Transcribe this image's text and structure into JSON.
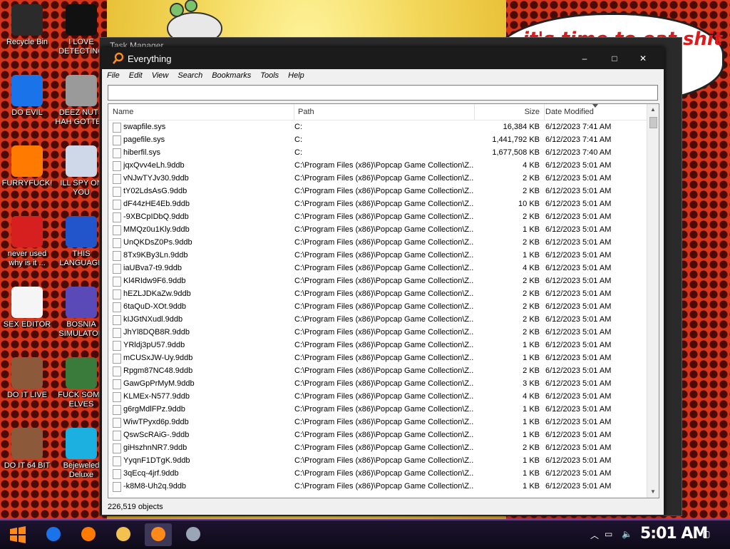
{
  "window": {
    "title": "Everything",
    "bg_title": "Task Manager"
  },
  "speech": {
    "text": "it's time to eat shit\n          w"
  },
  "desktop_icons": [
    {
      "label": "Recycle Bin",
      "color": "#2b2b2b"
    },
    {
      "label": "I LOVE\nDETECTING",
      "color": "#111111"
    },
    {
      "label": "DO EVIL",
      "color": "#1a73e8"
    },
    {
      "label": "DEEZ NUTS\nHAH GOTTEM",
      "color": "#9a9a9a"
    },
    {
      "label": "FURRYFUCK!",
      "color": "#ff7a00"
    },
    {
      "label": "ILL SPY ON\nYOU",
      "color": "#cfd8e8"
    },
    {
      "label": "never used\nwhy is it ...",
      "color": "#d62020"
    },
    {
      "label": "THIS\nLANGUAGE",
      "color": "#2255cc"
    },
    {
      "label": "SEX EDITOR",
      "color": "#f5f5f5"
    },
    {
      "label": "BOSNIA\nSIMULATOR",
      "color": "#5a4ab8"
    },
    {
      "label": "DO IT LIVE",
      "color": "#8c5a3a"
    },
    {
      "label": "FUCK SOME\nELVES",
      "color": "#3a7a3a"
    },
    {
      "label": "DO IT 64 BIT",
      "color": "#8c5a3a"
    },
    {
      "label": "Bejeweled\nDeluxe",
      "color": "#1bb0e0"
    }
  ],
  "menu": [
    "File",
    "Edit",
    "View",
    "Search",
    "Bookmarks",
    "Tools",
    "Help"
  ],
  "search": {
    "value": ""
  },
  "columns": {
    "name": "Name",
    "path": "Path",
    "size": "Size",
    "date": "Date Modified"
  },
  "files": [
    {
      "name": "swapfile.sys",
      "path": "C:",
      "size": "16,384 KB",
      "date": "6/12/2023 7:41 AM"
    },
    {
      "name": "pagefile.sys",
      "path": "C:",
      "size": "1,441,792 KB",
      "date": "6/12/2023 7:41 AM"
    },
    {
      "name": "hiberfil.sys",
      "path": "C:",
      "size": "1,677,508 KB",
      "date": "6/12/2023 7:40 AM"
    },
    {
      "name": "jqxQvv4eLh.9ddb",
      "path": "C:\\Program Files (x86)\\Popcap Game Collection\\Z...",
      "size": "4 KB",
      "date": "6/12/2023 5:01 AM"
    },
    {
      "name": "vNJwTYJv30.9ddb",
      "path": "C:\\Program Files (x86)\\Popcap Game Collection\\Z...",
      "size": "2 KB",
      "date": "6/12/2023 5:01 AM"
    },
    {
      "name": "tY02LdsAsG.9ddb",
      "path": "C:\\Program Files (x86)\\Popcap Game Collection\\Z...",
      "size": "2 KB",
      "date": "6/12/2023 5:01 AM"
    },
    {
      "name": "dF44zHE4Eb.9ddb",
      "path": "C:\\Program Files (x86)\\Popcap Game Collection\\Z...",
      "size": "10 KB",
      "date": "6/12/2023 5:01 AM"
    },
    {
      "name": "-9XBCpIDbQ.9ddb",
      "path": "C:\\Program Files (x86)\\Popcap Game Collection\\Z...",
      "size": "2 KB",
      "date": "6/12/2023 5:01 AM"
    },
    {
      "name": "MMQz0u1Kly.9ddb",
      "path": "C:\\Program Files (x86)\\Popcap Game Collection\\Z...",
      "size": "1 KB",
      "date": "6/12/2023 5:01 AM"
    },
    {
      "name": "UnQKDsZ0Ps.9ddb",
      "path": "C:\\Program Files (x86)\\Popcap Game Collection\\Z...",
      "size": "2 KB",
      "date": "6/12/2023 5:01 AM"
    },
    {
      "name": "8Tx9KBy3Ln.9ddb",
      "path": "C:\\Program Files (x86)\\Popcap Game Collection\\Z...",
      "size": "1 KB",
      "date": "6/12/2023 5:01 AM"
    },
    {
      "name": "iaUBva7-t9.9ddb",
      "path": "C:\\Program Files (x86)\\Popcap Game Collection\\Z...",
      "size": "4 KB",
      "date": "6/12/2023 5:01 AM"
    },
    {
      "name": "Kl4RIdw9F6.9ddb",
      "path": "C:\\Program Files (x86)\\Popcap Game Collection\\Z...",
      "size": "2 KB",
      "date": "6/12/2023 5:01 AM"
    },
    {
      "name": "hEZLJDKaZw.9ddb",
      "path": "C:\\Program Files (x86)\\Popcap Game Collection\\Z...",
      "size": "2 KB",
      "date": "6/12/2023 5:01 AM"
    },
    {
      "name": "6taQuD-XOt.9ddb",
      "path": "C:\\Program Files (x86)\\Popcap Game Collection\\Z...",
      "size": "2 KB",
      "date": "6/12/2023 5:01 AM"
    },
    {
      "name": "kIJGtNXudl.9ddb",
      "path": "C:\\Program Files (x86)\\Popcap Game Collection\\Z...",
      "size": "2 KB",
      "date": "6/12/2023 5:01 AM"
    },
    {
      "name": "JhYl8DQB8R.9ddb",
      "path": "C:\\Program Files (x86)\\Popcap Game Collection\\Z...",
      "size": "2 KB",
      "date": "6/12/2023 5:01 AM"
    },
    {
      "name": "YRldj3pU57.9ddb",
      "path": "C:\\Program Files (x86)\\Popcap Game Collection\\Z...",
      "size": "1 KB",
      "date": "6/12/2023 5:01 AM"
    },
    {
      "name": "mCUSxJW-Uy.9ddb",
      "path": "C:\\Program Files (x86)\\Popcap Game Collection\\Z...",
      "size": "1 KB",
      "date": "6/12/2023 5:01 AM"
    },
    {
      "name": "Rpgm87NC48.9ddb",
      "path": "C:\\Program Files (x86)\\Popcap Game Collection\\Z...",
      "size": "2 KB",
      "date": "6/12/2023 5:01 AM"
    },
    {
      "name": "GawGpPrMyM.9ddb",
      "path": "C:\\Program Files (x86)\\Popcap Game Collection\\Z...",
      "size": "3 KB",
      "date": "6/12/2023 5:01 AM"
    },
    {
      "name": "KLMEx-N577.9ddb",
      "path": "C:\\Program Files (x86)\\Popcap Game Collection\\Z...",
      "size": "4 KB",
      "date": "6/12/2023 5:01 AM"
    },
    {
      "name": "g6rgMdlFPz.9ddb",
      "path": "C:\\Program Files (x86)\\Popcap Game Collection\\Z...",
      "size": "1 KB",
      "date": "6/12/2023 5:01 AM"
    },
    {
      "name": "WiwTPyxd6p.9ddb",
      "path": "C:\\Program Files (x86)\\Popcap Game Collection\\Z...",
      "size": "1 KB",
      "date": "6/12/2023 5:01 AM"
    },
    {
      "name": "QswScRAiG-.9ddb",
      "path": "C:\\Program Files (x86)\\Popcap Game Collection\\Z...",
      "size": "1 KB",
      "date": "6/12/2023 5:01 AM"
    },
    {
      "name": "giHszhnNR7.9ddb",
      "path": "C:\\Program Files (x86)\\Popcap Game Collection\\Z...",
      "size": "2 KB",
      "date": "6/12/2023 5:01 AM"
    },
    {
      "name": "YyqnF1DTgK.9ddb",
      "path": "C:\\Program Files (x86)\\Popcap Game Collection\\Z...",
      "size": "1 KB",
      "date": "6/12/2023 5:01 AM"
    },
    {
      "name": "3qEcq-4jrf.9ddb",
      "path": "C:\\Program Files (x86)\\Popcap Game Collection\\Z...",
      "size": "1 KB",
      "date": "6/12/2023 5:01 AM"
    },
    {
      "name": "-k8M8-Uh2q.9ddb",
      "path": "C:\\Program Files (x86)\\Popcap Game Collection\\Z...",
      "size": "1 KB",
      "date": "6/12/2023 5:01 AM"
    }
  ],
  "status": {
    "count": "226,519 objects"
  },
  "taskbar": {
    "items": [
      {
        "name": "chrome-taskbar-icon",
        "color": "#1a73e8"
      },
      {
        "name": "firefox-taskbar-icon",
        "color": "#ff7a00"
      },
      {
        "name": "file-explorer-taskbar-icon",
        "color": "#f2c14e"
      },
      {
        "name": "everything-taskbar-icon",
        "color": "#ff8a1a"
      },
      {
        "name": "task-manager-taskbar-icon",
        "color": "#9aa6b8"
      }
    ],
    "clock": "5:01 AM"
  }
}
